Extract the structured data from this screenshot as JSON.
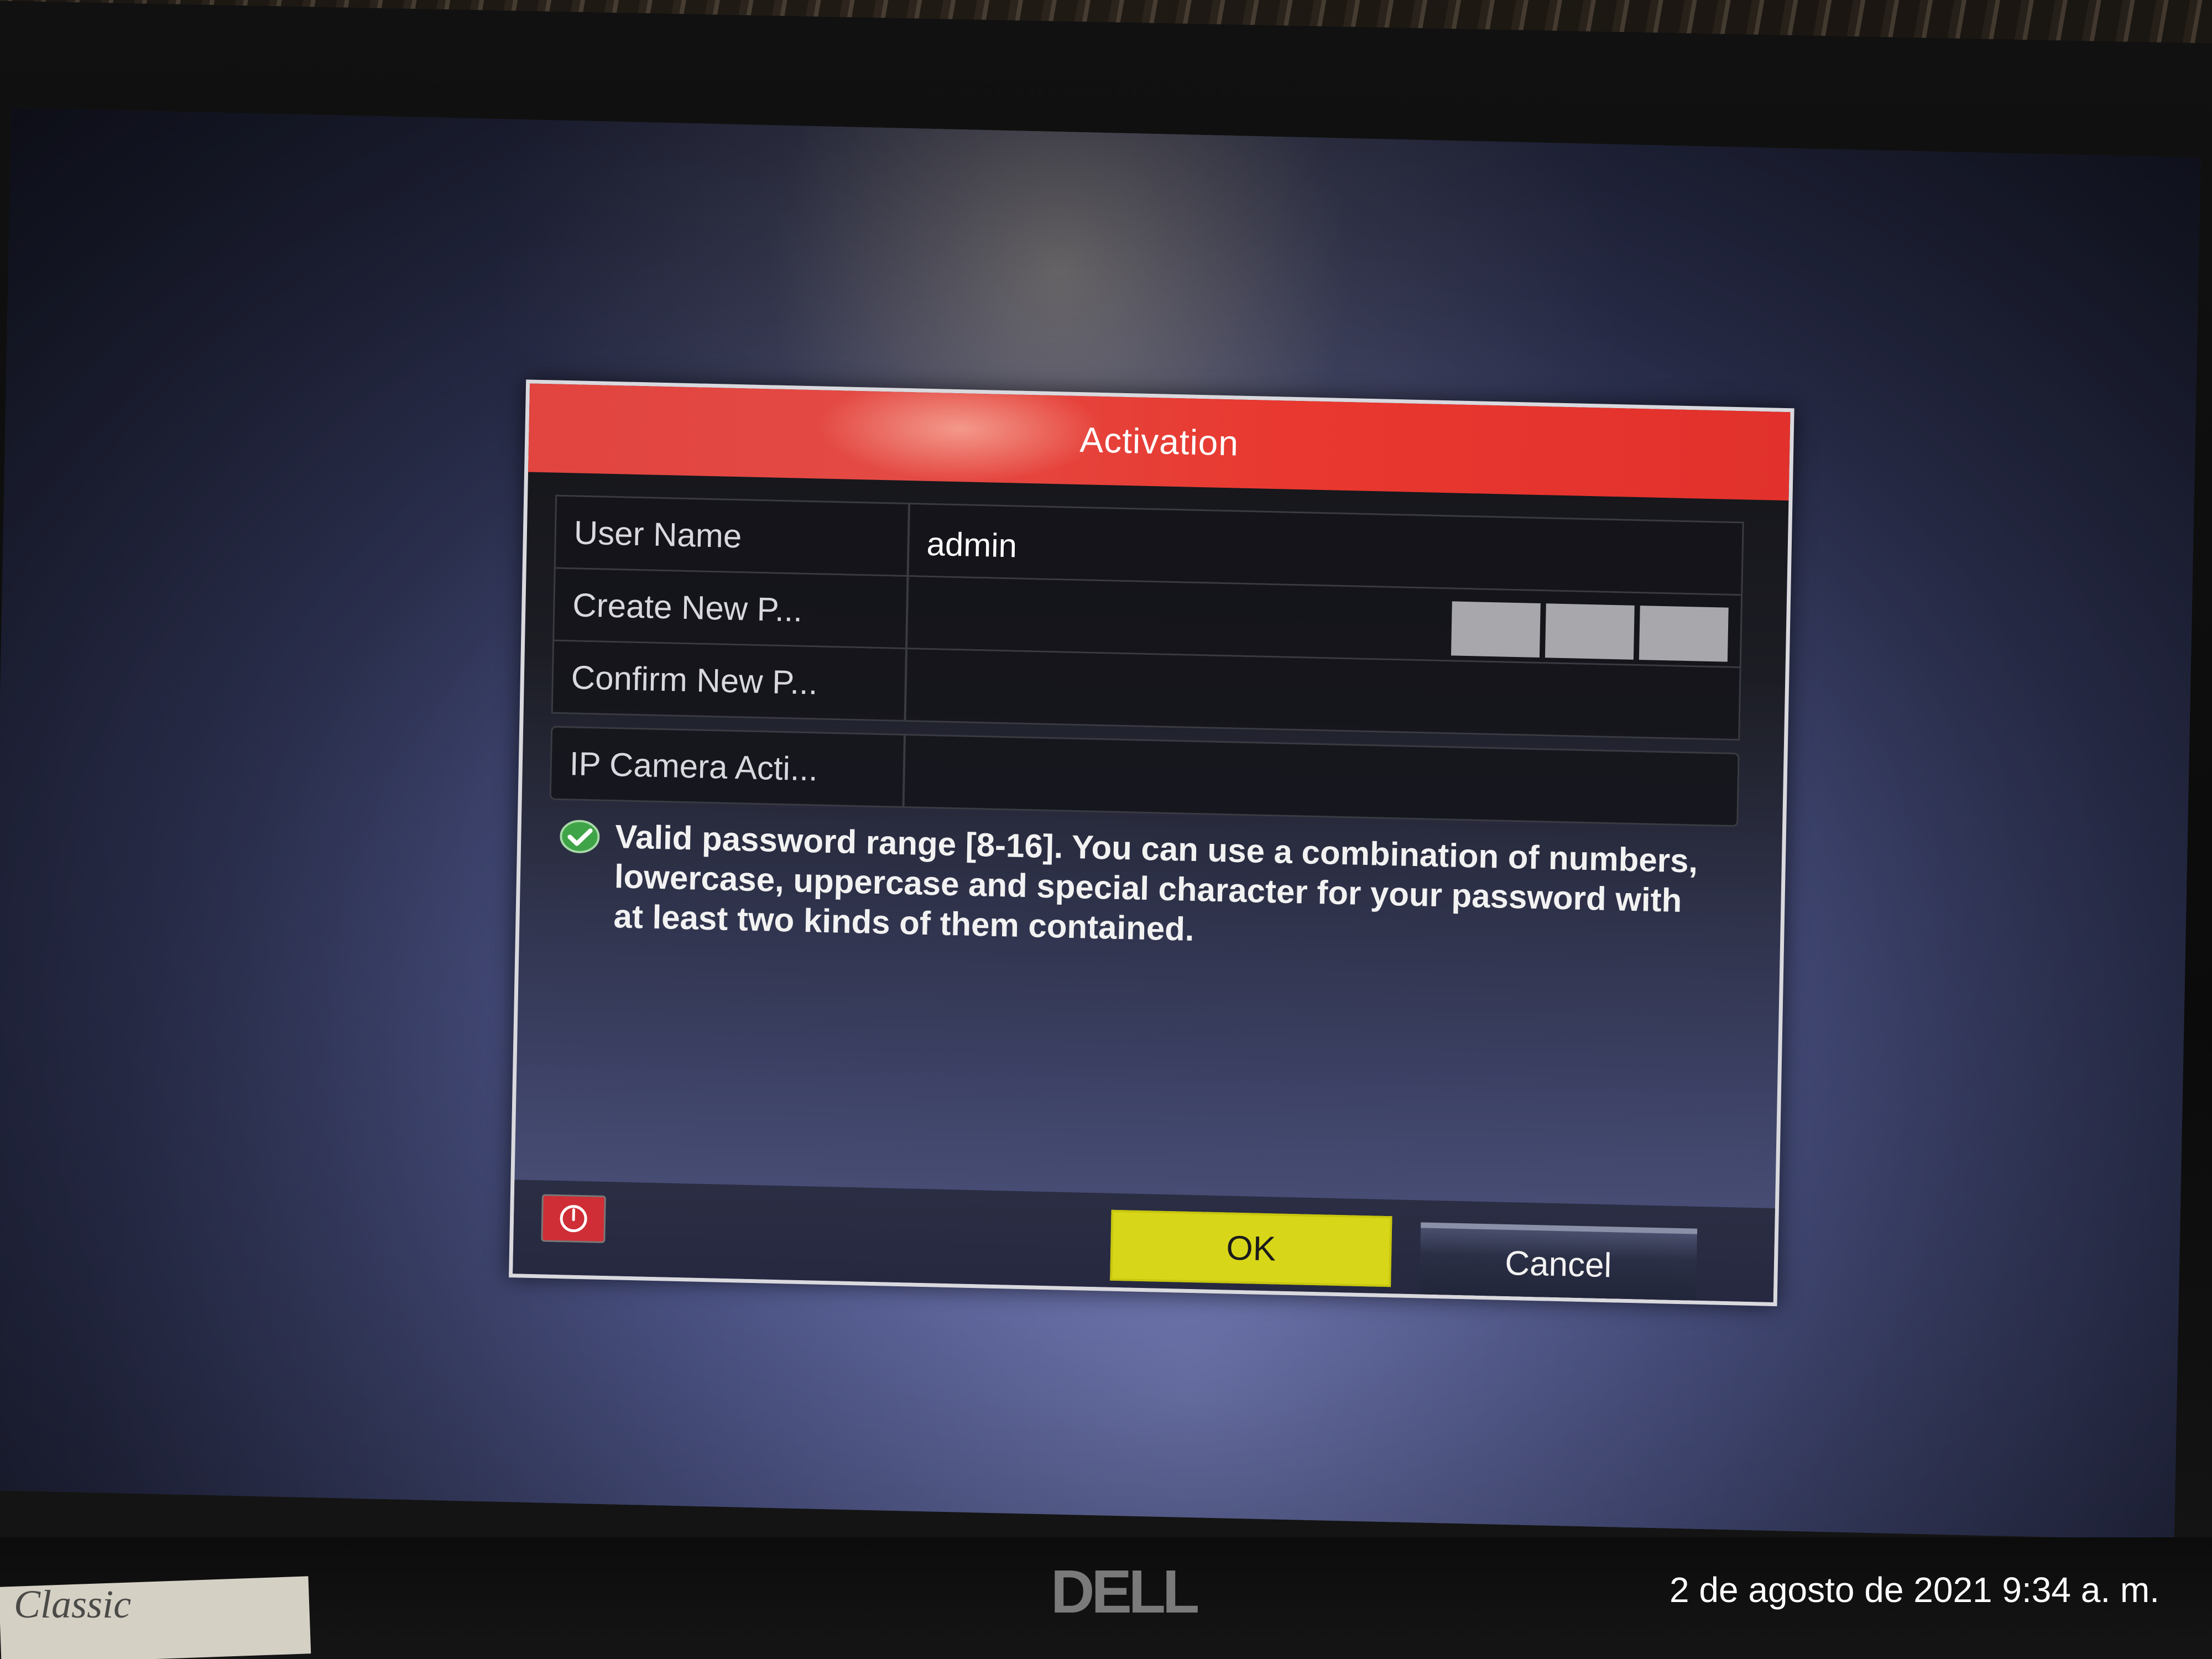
{
  "dialog": {
    "title": "Activation",
    "rows": [
      {
        "label": "User Name",
        "value": "admin"
      },
      {
        "label": "Create New P...",
        "value": ""
      },
      {
        "label": "Confirm New P...",
        "value": ""
      },
      {
        "label": "IP Camera Acti...",
        "value": ""
      }
    ],
    "hint": "Valid password range [8-16]. You can use a combination of numbers, lowercase, uppercase and special character for your password with at least two kinds of them contained.",
    "ok_label": "OK",
    "cancel_label": "Cancel"
  },
  "monitor": {
    "brand": "DELL"
  },
  "paper_label": "Classic",
  "timestamp": "2 de agosto de 2021 9:34 a. m.",
  "colors": {
    "header_red": "#e2443f",
    "ok_yellow": "#d8d619",
    "power_red": "#cf2e36",
    "check_green": "#3fa447"
  },
  "icons": [
    "power-icon",
    "check-icon"
  ]
}
